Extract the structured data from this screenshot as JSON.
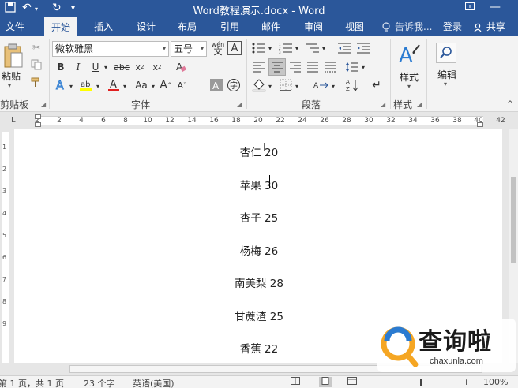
{
  "window": {
    "title": "Word教程演示.docx - Word"
  },
  "tabs": [
    {
      "label": "文件",
      "active": false
    },
    {
      "label": "开始",
      "active": true
    },
    {
      "label": "插入",
      "active": false
    },
    {
      "label": "设计",
      "active": false
    },
    {
      "label": "布局",
      "active": false
    },
    {
      "label": "引用",
      "active": false
    },
    {
      "label": "邮件",
      "active": false
    },
    {
      "label": "审阅",
      "active": false
    },
    {
      "label": "视图",
      "active": false
    }
  ],
  "tell_me": "告诉我...",
  "login": "登录",
  "share": "共享",
  "ribbon": {
    "clipboard": {
      "paste_label": "粘贴",
      "group_label": "剪贴板"
    },
    "font": {
      "font_name": "微软雅黑",
      "font_size": "五号",
      "group_label": "字体",
      "wen_label": "wén\n文",
      "a_label": "A"
    },
    "paragraph": {
      "group_label": "段落"
    },
    "styles": {
      "button_label": "样式",
      "group_label": "样式"
    },
    "editing": {
      "button_label": "编辑"
    }
  },
  "ruler": {
    "numbers": [
      "2",
      "2",
      "4",
      "6",
      "8",
      "10",
      "12",
      "14",
      "16",
      "18",
      "20",
      "22",
      "24",
      "26",
      "28",
      "30",
      "32",
      "34",
      "36",
      "38",
      "40",
      "42"
    ]
  },
  "vruler": {
    "numbers": [
      "1",
      "2",
      "3",
      "4",
      "5",
      "6",
      "7",
      "8",
      "9"
    ]
  },
  "document": {
    "lines": [
      "杏仁 20",
      "苹果 30",
      "杏子 25",
      "杨梅 26",
      "南美梨 28",
      "甘蔗渣 25",
      "香蕉 22"
    ]
  },
  "status": {
    "page": "第 1 页，共 1 页",
    "words": "23 个字",
    "language": "英语(美国)",
    "zoom": "100%"
  },
  "watermark": {
    "title": "查询啦",
    "url": "chaxunla.com"
  }
}
